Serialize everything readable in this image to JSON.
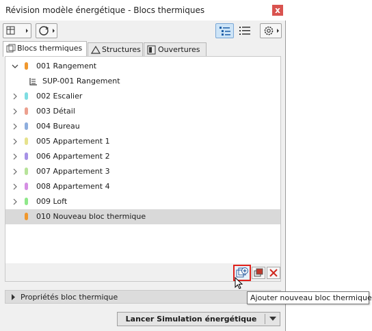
{
  "window": {
    "title": "Révision modèle énergétique - Blocs thermiques",
    "close": "x"
  },
  "tabs": [
    {
      "label": "Blocs thermiques"
    },
    {
      "label": "Structures"
    },
    {
      "label": "Ouvertures"
    }
  ],
  "tree": {
    "parent": {
      "label": "001 Rangement",
      "color": "#f0982e"
    },
    "child": {
      "label": "SUP-001 Rangement"
    },
    "items": [
      {
        "label": "002 Escalier",
        "color": "#7fdde2"
      },
      {
        "label": "003 Détail",
        "color": "#eca08f"
      },
      {
        "label": "004 Bureau",
        "color": "#8eaede"
      },
      {
        "label": "005 Appartement 1",
        "color": "#e6e28d"
      },
      {
        "label": "006 Appartement 2",
        "color": "#a792e6"
      },
      {
        "label": "007 Appartement 3",
        "color": "#b7e39a"
      },
      {
        "label": "008 Appartement 4",
        "color": "#d58fe3"
      },
      {
        "label": "009 Loft",
        "color": "#8fe88a"
      }
    ],
    "selected": {
      "label": "010 Nouveau bloc thermique",
      "color": "#f0982e"
    }
  },
  "properties": {
    "label": "Propriétés bloc thermique"
  },
  "simulation": {
    "label": "Lancer Simulation énergétique"
  },
  "tooltip": {
    "text": "Ajouter nouveau bloc thermique"
  }
}
